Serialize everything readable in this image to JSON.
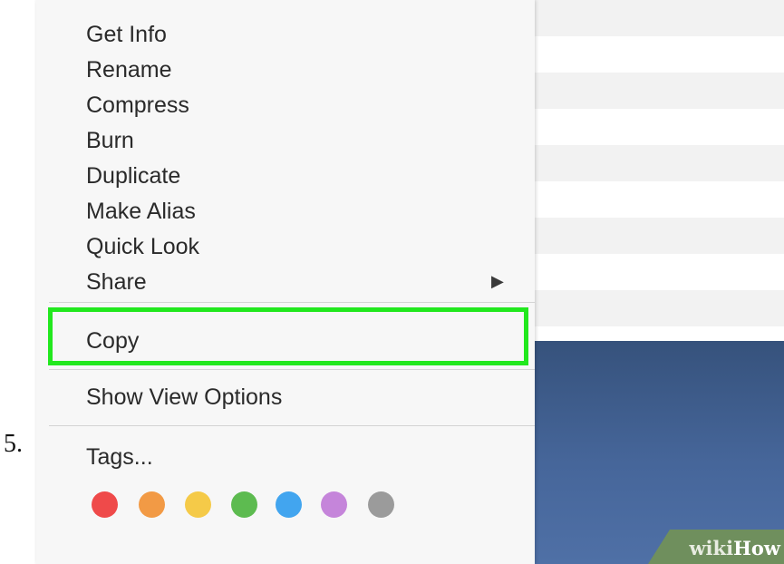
{
  "step_number": "5.",
  "context_menu": {
    "items": [
      {
        "label": "Get Info"
      },
      {
        "label": "Rename"
      },
      {
        "label": "Compress"
      },
      {
        "label": "Burn"
      },
      {
        "label": "Duplicate"
      },
      {
        "label": "Make Alias"
      },
      {
        "label": "Quick Look"
      },
      {
        "label": "Share",
        "has_submenu": true,
        "submenu_icon": "triangle-right-icon"
      }
    ],
    "copy_item": {
      "label": "Copy",
      "highlighted": true,
      "highlight_color": "#22e81e"
    },
    "view_options": {
      "label": "Show View Options"
    },
    "tags": {
      "label": "Tags...",
      "colors": [
        {
          "name": "red",
          "hex": "#ef4a4a"
        },
        {
          "name": "orange",
          "hex": "#f29a45"
        },
        {
          "name": "yellow",
          "hex": "#f5ca48"
        },
        {
          "name": "green",
          "hex": "#5dbb50"
        },
        {
          "name": "blue",
          "hex": "#42a5ef"
        },
        {
          "name": "purple",
          "hex": "#c585da"
        },
        {
          "name": "gray",
          "hex": "#9b9b9b"
        }
      ]
    }
  },
  "watermark": {
    "part1": "wiki",
    "part2": "How"
  }
}
